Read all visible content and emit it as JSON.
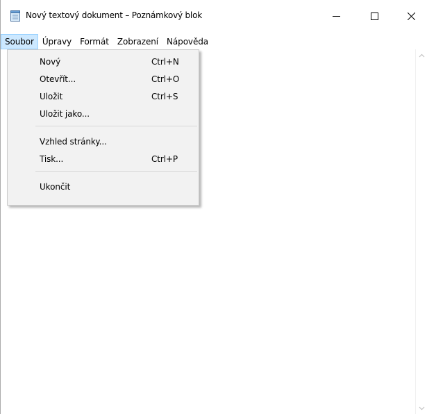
{
  "window": {
    "title": "Nový textový dokument – Poznámkový blok",
    "icon": "notepad-icon",
    "controls": {
      "minimize": "minimize-icon",
      "maximize": "maximize-icon",
      "close": "close-icon"
    }
  },
  "menubar": {
    "items": [
      {
        "label": "Soubor",
        "active": true
      },
      {
        "label": "Úpravy",
        "active": false
      },
      {
        "label": "Formát",
        "active": false
      },
      {
        "label": "Zobrazení",
        "active": false
      },
      {
        "label": "Nápověda",
        "active": false
      }
    ]
  },
  "file_menu": {
    "items": [
      {
        "label": "Nový",
        "shortcut": "Ctrl+N"
      },
      {
        "label": "Otevřít...",
        "shortcut": "Ctrl+O"
      },
      {
        "label": "Uložit",
        "shortcut": "Ctrl+S"
      },
      {
        "label": "Uložit jako...",
        "shortcut": ""
      },
      {
        "label": "Vzhled stránky...",
        "shortcut": ""
      },
      {
        "label": "Tisk...",
        "shortcut": "Ctrl+P"
      },
      {
        "label": "Ukončit",
        "shortcut": ""
      }
    ]
  },
  "editor": {
    "content": ""
  },
  "colors": {
    "menu_highlight": "#cce8ff",
    "menu_highlight_border": "#99d1ff",
    "dropdown_bg": "#f2f2f2"
  }
}
